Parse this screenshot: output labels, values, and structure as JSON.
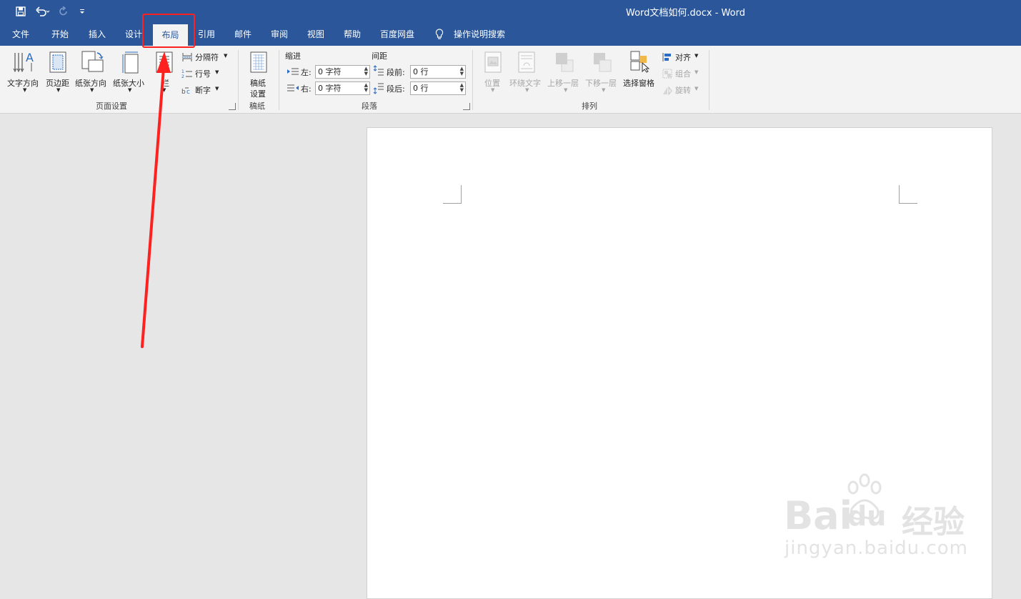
{
  "window": {
    "title": "Word文档如何.docx  -  Word"
  },
  "qat": {
    "save_icon": "save-icon",
    "undo_icon": "undo-icon",
    "redo_icon": "redo-icon",
    "customize_icon": "customize-qat-icon"
  },
  "tabs": [
    {
      "label": "文件"
    },
    {
      "label": "开始"
    },
    {
      "label": "插入"
    },
    {
      "label": "设计"
    },
    {
      "label": "布局"
    },
    {
      "label": "引用"
    },
    {
      "label": "邮件"
    },
    {
      "label": "审阅"
    },
    {
      "label": "视图"
    },
    {
      "label": "帮助"
    },
    {
      "label": "百度网盘"
    },
    {
      "label": "操作说明搜索"
    }
  ],
  "active_tab": "布局",
  "ribbon": {
    "page_setup": {
      "label": "页面设置",
      "text_direction": "文字方向",
      "margins": "页边距",
      "orientation": "纸张方向",
      "size": "纸张大小",
      "columns": "栏",
      "breaks": "分隔符",
      "line_numbers": "行号",
      "hyphenation": "断字"
    },
    "draft": {
      "label": "稿纸",
      "button_line1": "稿纸",
      "button_line2": "设置"
    },
    "paragraph": {
      "label": "段落",
      "indent_header": "缩进",
      "spacing_header": "间距",
      "left_label": "左:",
      "left_value": "0 字符",
      "right_label": "右:",
      "right_value": "0 字符",
      "before_label": "段前:",
      "before_value": "0 行",
      "after_label": "段后:",
      "after_value": "0 行"
    },
    "arrange": {
      "label": "排列",
      "position": "位置",
      "wrap_text": "环绕文字",
      "bring_forward": "上移一层",
      "send_backward": "下移一层",
      "selection_pane": "选择窗格",
      "align": "对齐",
      "group": "组合",
      "rotate": "旋转"
    }
  },
  "watermark": {
    "brand_a": "Bai",
    "brand_b": "du",
    "brand_cn": "经验",
    "url": "jingyan.baidu.com"
  },
  "colors": {
    "brand": "#2b579a",
    "ribbon": "#f3f3f3",
    "annotation": "#ff2020"
  }
}
